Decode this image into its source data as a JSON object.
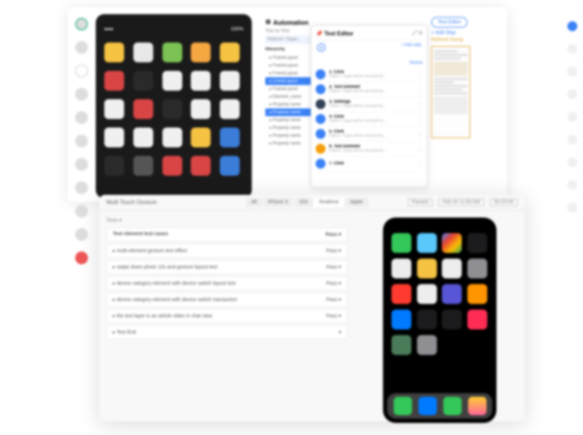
{
  "back": {
    "automation_title": "Automation",
    "step_by": "Step by Step",
    "hierarchy": "Hierarchy",
    "tree": [
      {
        "label": "FrameLayout",
        "sel": false
      },
      {
        "label": "FrameLayout",
        "sel": false
      },
      {
        "label": "FrameLayout",
        "sel": false
      },
      {
        "label": "LinearLayout",
        "sel": true
      },
      {
        "label": "FrameLayout",
        "sel": false
      },
      {
        "label": "Element_name",
        "sel": false
      },
      {
        "label": "Property name",
        "sel": false
      },
      {
        "label": "Property name",
        "sel": true
      },
      {
        "label": "Property name",
        "sel": false
      },
      {
        "label": "Property name",
        "sel": false
      },
      {
        "label": "Property name",
        "sel": false
      },
      {
        "label": "Property name",
        "sel": false
      }
    ],
    "test_editor": {
      "title": "Test Editor",
      "add_step": "+ Add step",
      "device": "Device",
      "steps": [
        {
          "n": "1",
          "title": "Click",
          "sub": "Pattern: Target will be executed by...",
          "color": "#3b82f6"
        },
        {
          "n": "2",
          "title": "Text Element",
          "sub": "Pattern: Target will be executed by...",
          "color": "#3b82f6"
        },
        {
          "n": "3",
          "title": "Settings",
          "sub": "Pattern: Target will be executed by...",
          "color": "#334155"
        },
        {
          "n": "4",
          "title": "Click",
          "sub": "Pattern: Target will be executed by...",
          "color": "#3b82f6"
        },
        {
          "n": "5",
          "title": "Click",
          "sub": "Pattern: Target will be executed by...",
          "color": "#3b82f6"
        },
        {
          "n": "6",
          "title": "Text Element",
          "sub": "Pattern: Target will be executed by...",
          "color": "#f59e0b"
        },
        {
          "n": "7",
          "title": "Click",
          "sub": "",
          "color": "#3b82f6"
        }
      ]
    },
    "right": {
      "test_editor_btn": "Test Editor",
      "add_step": "+ Add Step",
      "refresh": "Refresh Dump"
    },
    "tablet_apps": [
      {
        "c": "#f5c242"
      },
      {
        "c": "#e8e8e8"
      },
      {
        "c": "#7cc254"
      },
      {
        "c": "#f5a742"
      },
      {
        "c": "#f5c242"
      },
      {
        "c": "#d94545"
      },
      {
        "c": "#2a2a2a"
      },
      {
        "c": "#f0f0f0"
      },
      {
        "c": "#f0f0f0"
      },
      {
        "c": "#f0f0f0"
      },
      {
        "c": "#f0f0f0"
      },
      {
        "c": "#d94545"
      },
      {
        "c": "#2a2a2a"
      },
      {
        "c": "#f0f0f0"
      },
      {
        "c": "#f0f0f0"
      },
      {
        "c": "#f0f0f0"
      },
      {
        "c": "#f0f0f0"
      },
      {
        "c": "#f0f0f0"
      },
      {
        "c": "#f5c242"
      },
      {
        "c": "#3b7dd8"
      },
      {
        "c": "#2a2a2a"
      },
      {
        "c": "#555"
      },
      {
        "c": "#d94545"
      },
      {
        "c": "#d94545"
      },
      {
        "c": "#3b7dd8"
      }
    ]
  },
  "front": {
    "title": "Multi Touch Gesture",
    "tabs": [
      "All",
      "iPhone X",
      "iOS",
      "Realtime",
      "Apple"
    ],
    "status": "Passed",
    "date": "Feb 20 11:00 AM",
    "duration": "00:20:00",
    "filter": "Tests",
    "col_header_name": "Test element test cases",
    "col_header_result": "Pass",
    "rows": [
      {
        "name": "multi element gesture test effect",
        "result": "Pass"
      },
      {
        "name": "swipe down photo 10s and gesture layout test",
        "result": "Pass"
      },
      {
        "name": "device category element with device switch layout test",
        "result": "Pass"
      },
      {
        "name": "device category element with device switch transaction",
        "result": "Pass"
      },
      {
        "name": "the text layer is an article video in chat view",
        "result": "Pass"
      },
      {
        "name": "Test End",
        "result": ""
      }
    ],
    "phone_apps": [
      {
        "c": "#34c759"
      },
      {
        "c": "#5ac8fa"
      },
      {
        "c": "linear-gradient(135deg,#4285f4,#ea4335,#fbbc05,#34a853)"
      },
      {
        "c": "#1c1c1e"
      },
      {
        "c": "#ededed"
      },
      {
        "c": "#f5c242"
      },
      {
        "c": "#ededed"
      },
      {
        "c": "#8e8e93"
      },
      {
        "c": "#ff3b30"
      },
      {
        "c": "#ededed"
      },
      {
        "c": "#5856d6"
      },
      {
        "c": "#ff9500"
      },
      {
        "c": "#007aff"
      },
      {
        "c": "#1c1c1e"
      },
      {
        "c": "#1c1c1e"
      },
      {
        "c": "#ff2d55"
      },
      {
        "c": "#4a7c59"
      },
      {
        "c": "#8e8e93"
      }
    ],
    "dock_apps": [
      {
        "c": "#34c759"
      },
      {
        "c": "#007aff"
      },
      {
        "c": "#34c759"
      },
      {
        "c": "linear-gradient(#fc3,#f69)"
      }
    ]
  }
}
